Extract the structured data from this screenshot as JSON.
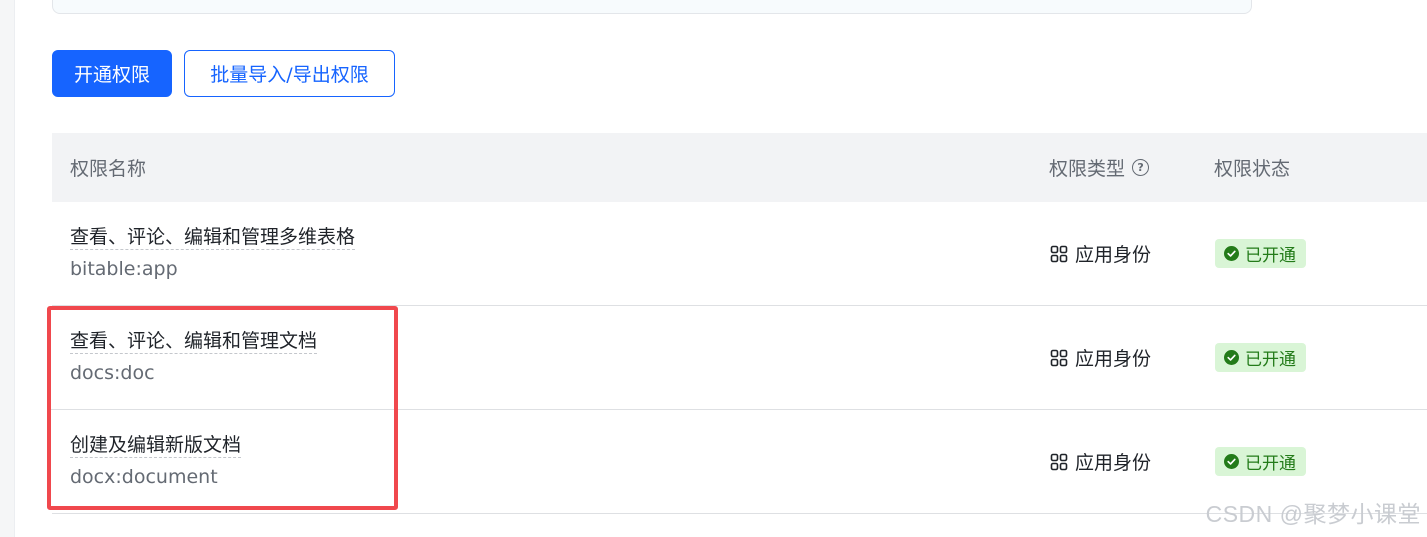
{
  "actions": {
    "enable_label": "开通权限",
    "batch_label": "批量导入/导出权限"
  },
  "table": {
    "headers": {
      "name": "权限名称",
      "type": "权限类型",
      "status": "权限状态"
    },
    "rows": [
      {
        "title": "查看、评论、编辑和管理多维表格",
        "code": "bitable:app",
        "type": "应用身份",
        "status": "已开通"
      },
      {
        "title": "查看、评论、编辑和管理文档",
        "code": "docs:doc",
        "type": "应用身份",
        "status": "已开通"
      },
      {
        "title": "创建及编辑新版文档",
        "code": "docx:document",
        "type": "应用身份",
        "status": "已开通"
      }
    ]
  },
  "help_icon_glyph": "?",
  "watermark": "CSDN @聚梦小课堂",
  "colors": {
    "primary": "#1664ff",
    "status_bg": "#d9f5d6",
    "status_text": "#237b19",
    "highlight": "#f0484d"
  },
  "icons": {
    "type_icon": "grid-icon",
    "status_icon": "check-circle-icon",
    "header_help_icon": "question-circle-icon"
  }
}
